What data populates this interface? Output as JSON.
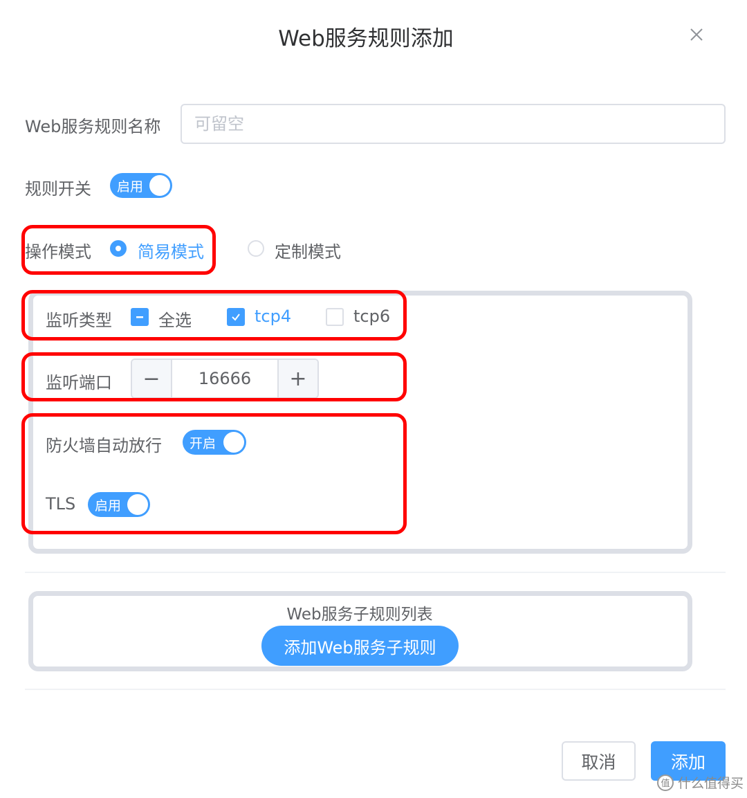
{
  "dialog": {
    "title": "Web服务规则添加",
    "close_icon": "close-icon"
  },
  "form": {
    "name": {
      "label": "Web服务规则名称",
      "value": "",
      "placeholder": "可留空"
    },
    "rule_switch": {
      "label": "规则开关",
      "state_text": "启用",
      "on": true
    },
    "mode": {
      "label": "操作模式",
      "options": [
        {
          "label": "简易模式",
          "selected": true
        },
        {
          "label": "定制模式",
          "selected": false
        }
      ]
    },
    "listen_type": {
      "label": "监听类型",
      "select_all": {
        "label": "全选",
        "state": "indeterminate"
      },
      "options": [
        {
          "label": "tcp4",
          "checked": true
        },
        {
          "label": "tcp6",
          "checked": false
        }
      ]
    },
    "listen_port": {
      "label": "监听端口",
      "value": "16666",
      "minus": "−",
      "plus": "+"
    },
    "firewall": {
      "label": "防火墙自动放行",
      "state_text": "开启",
      "on": true
    },
    "tls": {
      "label": "TLS",
      "state_text": "启用",
      "on": true
    }
  },
  "sub_rules": {
    "title": "Web服务子规则列表",
    "add_button": "添加Web服务子规则"
  },
  "footer": {
    "cancel": "取消",
    "submit": "添加"
  },
  "watermark": {
    "logo": "值",
    "text": "什么值得买"
  },
  "colors": {
    "primary": "#409eff",
    "highlight": "#ff0000",
    "border": "#dcdfe6"
  }
}
